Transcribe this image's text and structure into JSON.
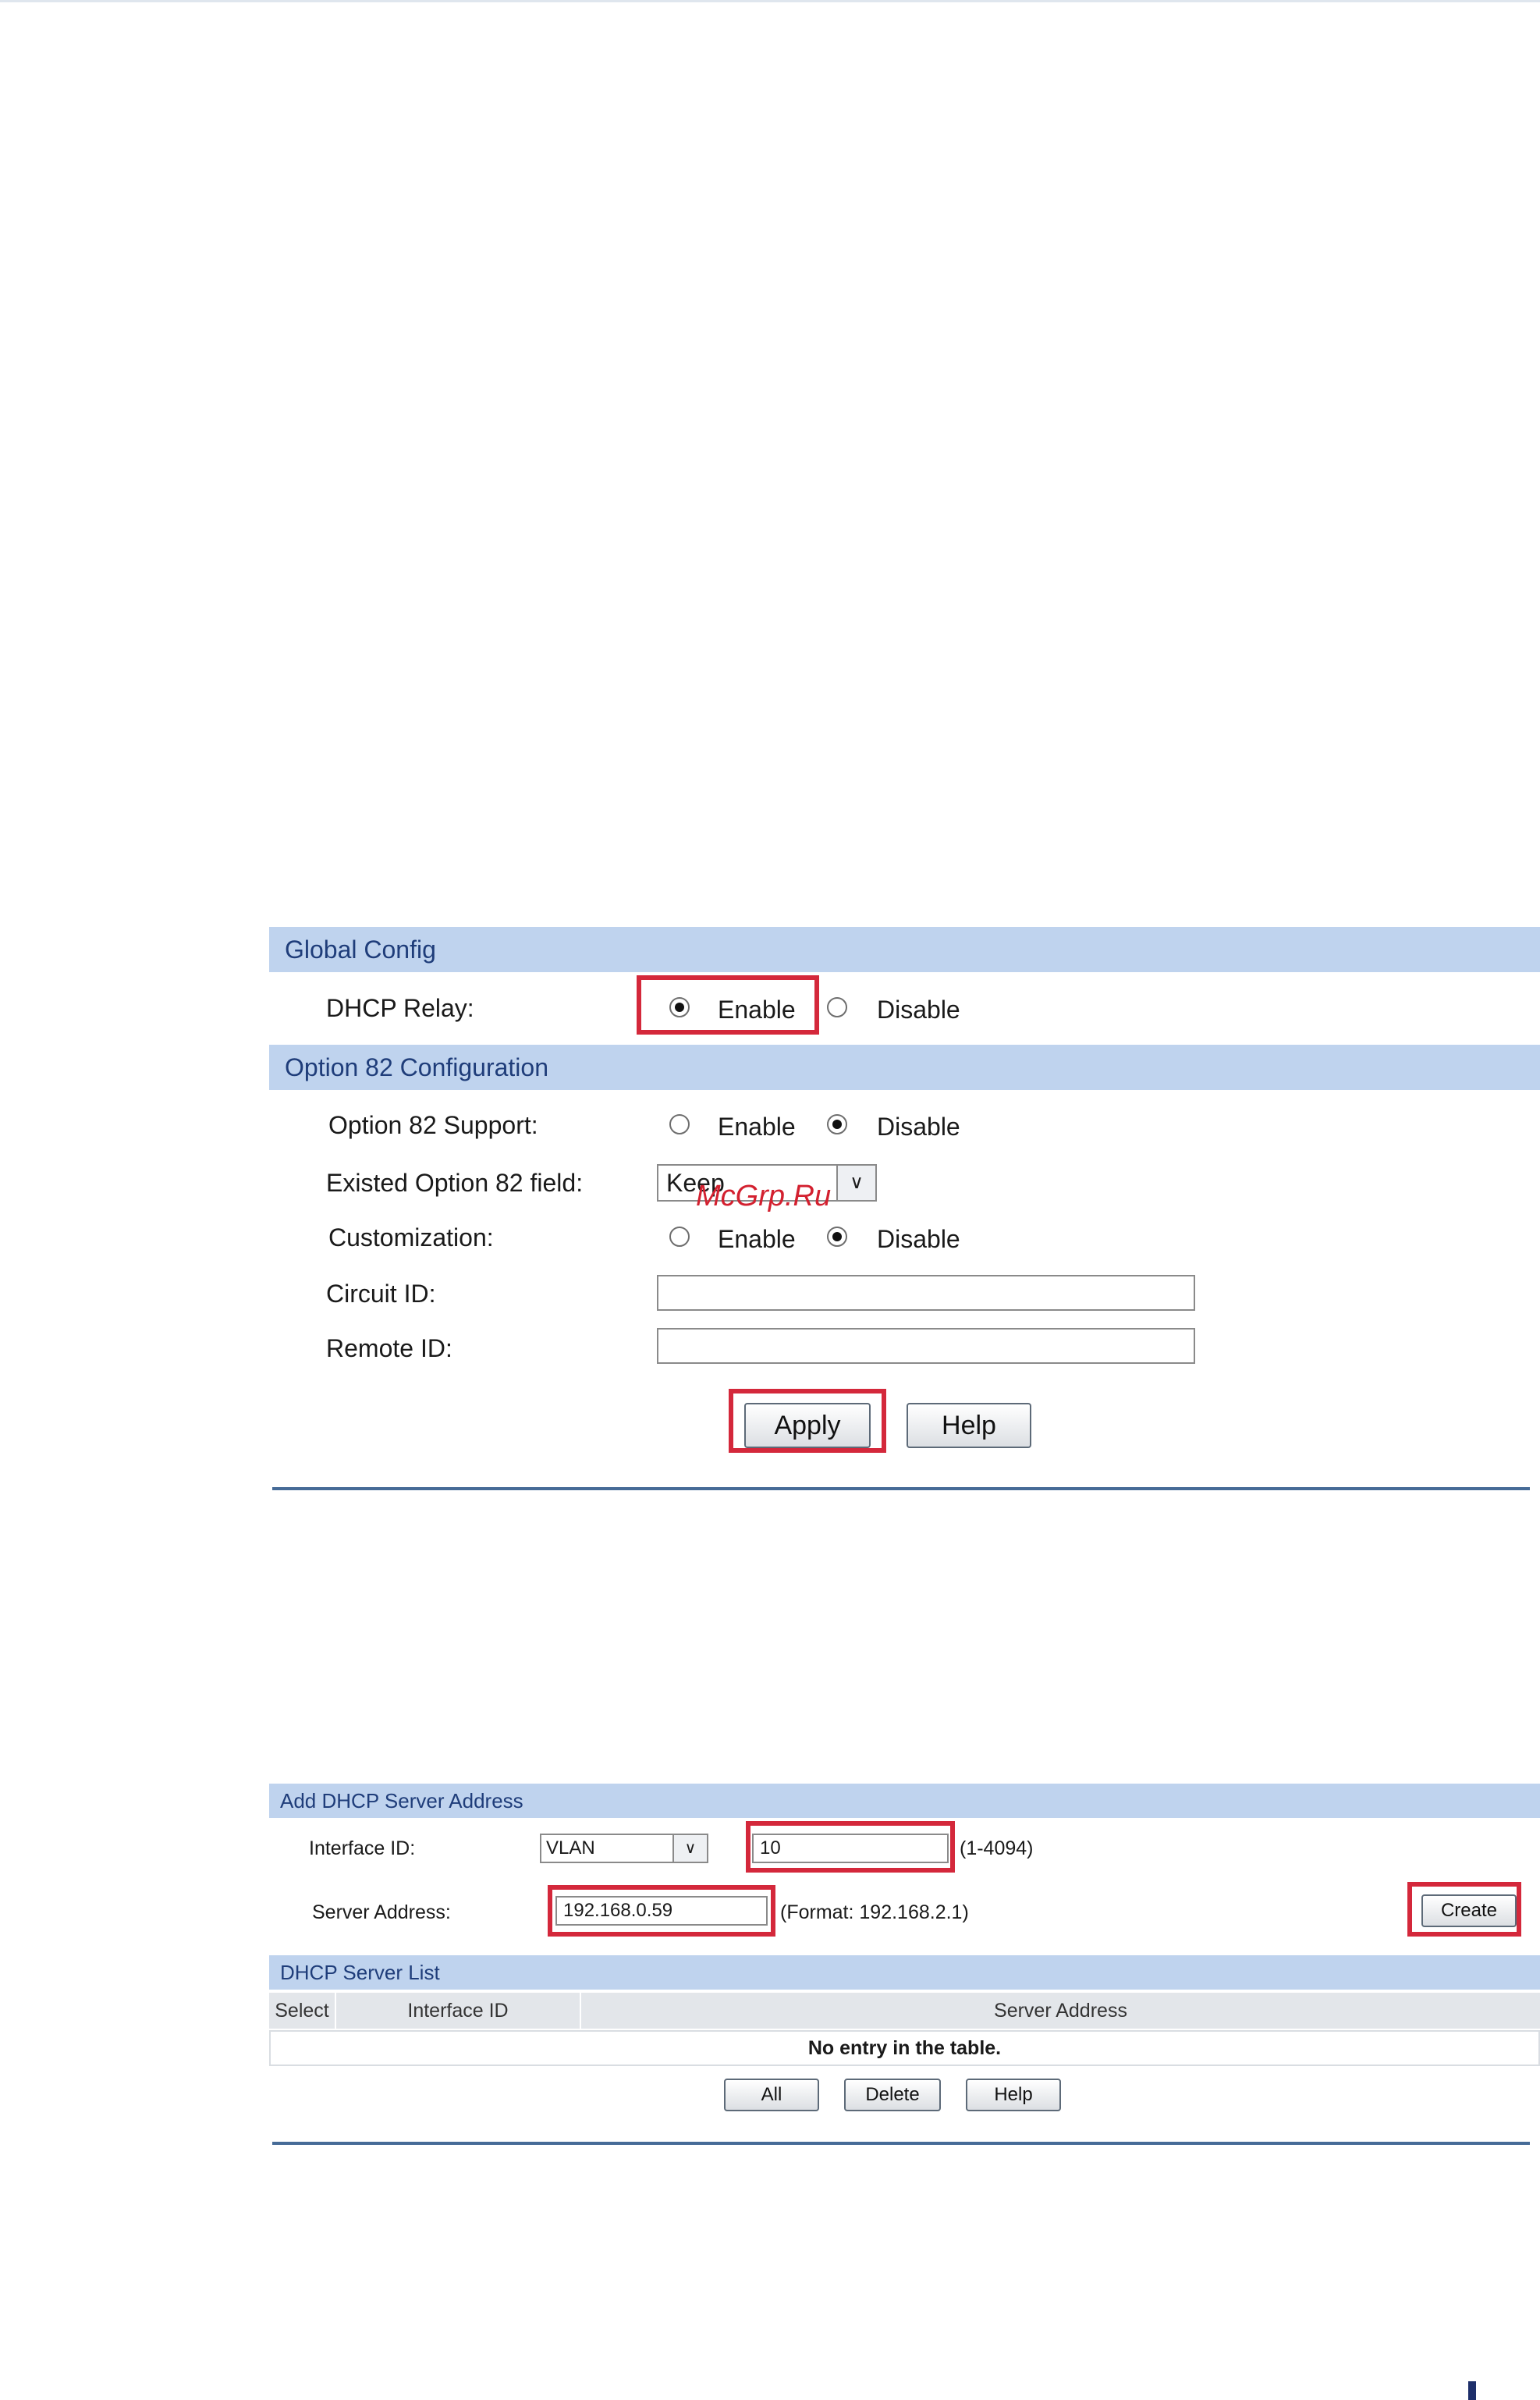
{
  "global_config": {
    "section_title": "Global Config",
    "dhcp_relay_label": "DHCP Relay:",
    "dhcp_relay_enable": "Enable",
    "dhcp_relay_disable": "Disable",
    "dhcp_relay_selected": "Enable"
  },
  "option82": {
    "section_title": "Option 82 Configuration",
    "support_label": "Option 82 Support:",
    "support_enable": "Enable",
    "support_disable": "Disable",
    "support_selected": "Disable",
    "existed_field_label": "Existed Option 82 field:",
    "existed_field_value": "Keep",
    "customization_label": "Customization:",
    "customization_enable": "Enable",
    "customization_disable": "Disable",
    "customization_selected": "Disable",
    "circuit_id_label": "Circuit ID:",
    "circuit_id_value": "",
    "remote_id_label": "Remote ID:",
    "remote_id_value": "",
    "apply_label": "Apply",
    "help_label": "Help"
  },
  "watermark": "McGrp.Ru",
  "add_server": {
    "section_title": "Add DHCP Server Address",
    "interface_id_label": "Interface ID:",
    "interface_type": "VLAN",
    "interface_value": "10",
    "interface_range": "(1-4094)",
    "server_address_label": "Server Address:",
    "server_address_value": "192.168.0.59",
    "server_address_format": "(Format: 192.168.2.1)",
    "create_label": "Create"
  },
  "server_list": {
    "section_title": "DHCP Server List",
    "columns": [
      "Select",
      "Interface ID",
      "Server Address"
    ],
    "empty_message": "No entry in the table.",
    "all_label": "All",
    "delete_label": "Delete",
    "help_label": "Help"
  },
  "colors": {
    "section_bar": "#bfd3ee",
    "highlight": "#d4283b",
    "divider": "#466b97"
  }
}
